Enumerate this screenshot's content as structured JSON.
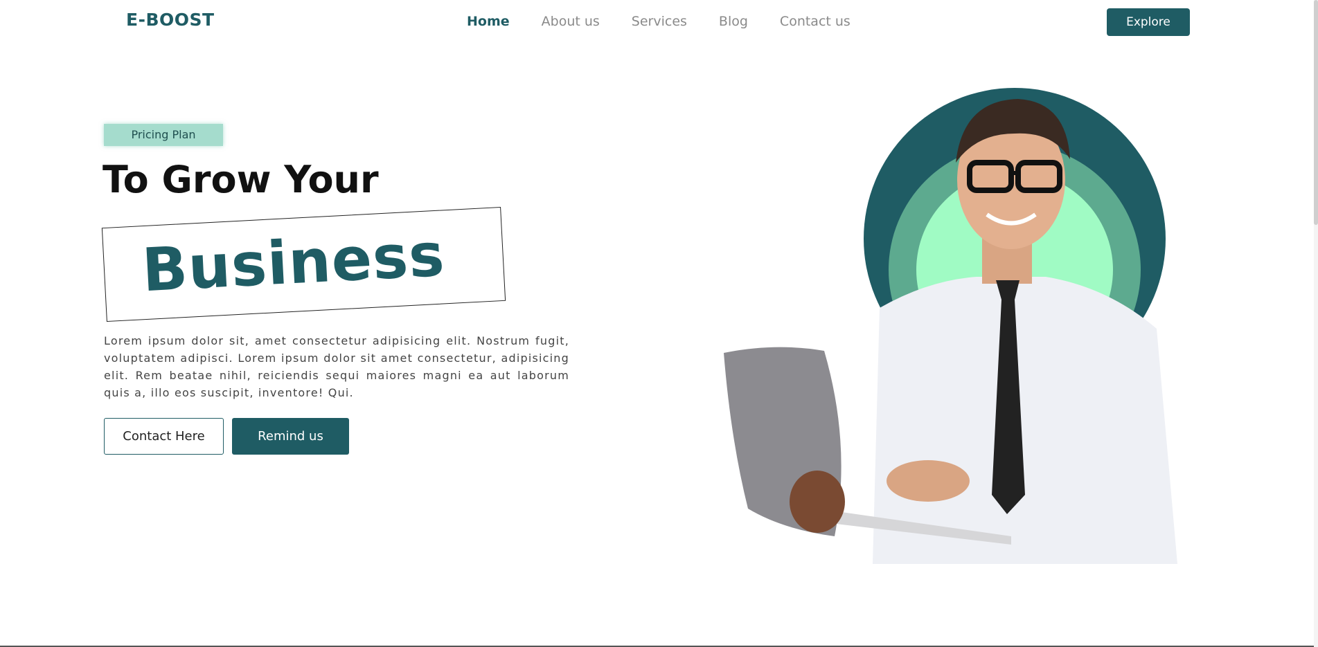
{
  "header": {
    "logo": "E-BOOST",
    "nav": [
      "Home",
      "About us",
      "Services",
      "Blog",
      "Contact us"
    ],
    "active_nav": "Home",
    "explore_label": "Explore"
  },
  "hero": {
    "badge": "Pricing Plan",
    "title_line1": "To Grow Your",
    "title_line2": "Business",
    "paragraph": "Lorem ipsum dolor sit, amet consectetur adipisicing elit. Nostrum fugit, voluptatem adipisci. Lorem ipsum dolor sit amet consectetur, adipisicing elit. Rem beatae nihil, reiciendis sequi maiores magni ea aut laborum quis a, illo eos suscipit, inventore! Qui.",
    "contact_label": "Contact Here",
    "remind_label": "Remind us"
  },
  "colors": {
    "brand": "#1f5c64",
    "badge_bg": "#a5dccd",
    "circle_mid": "#5daa8f",
    "circle_inner": "#a0fbc4"
  }
}
